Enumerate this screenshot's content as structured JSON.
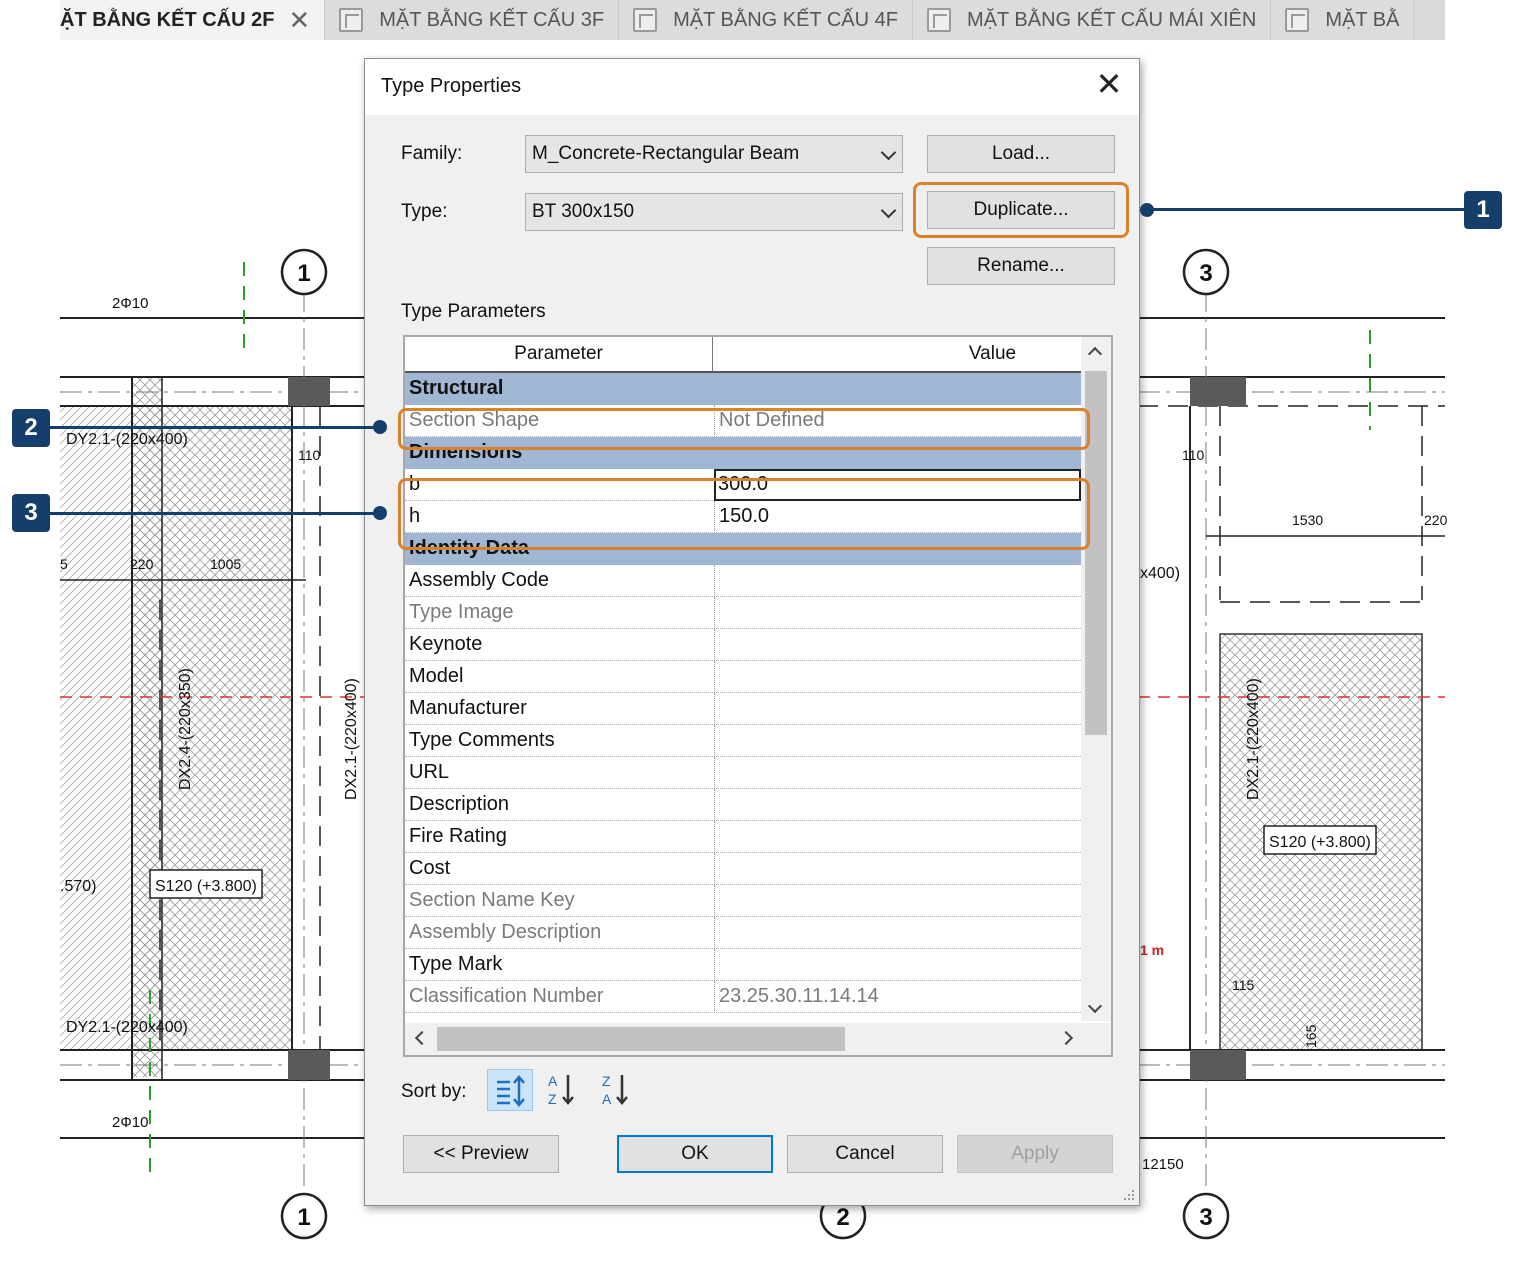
{
  "tabs": [
    {
      "label": "ẶT BẰNG KẾT CẤU 2F",
      "active": true
    },
    {
      "label": "MẶT BẰNG KẾT CẤU 3F",
      "active": false
    },
    {
      "label": "MẶT BẰNG KẾT CẤU 4F",
      "active": false
    },
    {
      "label": "MẶT BẰNG KẾT CẤU MÁI XIÊN",
      "active": false
    },
    {
      "label": "MẶT BẰ",
      "active": false
    }
  ],
  "drawing": {
    "grid_labels": [
      "1",
      "2",
      "3"
    ],
    "texts": [
      "2Ф10",
      "DY2.1-(220x400)",
      "110",
      "220",
      "1005",
      "5",
      "DX2.4-(220x350)",
      "DX2.1-(220x400)",
      ".570)",
      "S120 (+3.800)",
      "2Ф10",
      "1530",
      "220",
      "x400)",
      "1 m",
      "115",
      "165",
      "12150"
    ]
  },
  "dialog": {
    "title": "Type Properties",
    "family_label": "Family:",
    "family_value": "M_Concrete-Rectangular Beam",
    "type_label": "Type:",
    "type_value": "BT 300x150",
    "load_button": "Load...",
    "duplicate_button": "Duplicate...",
    "rename_button": "Rename...",
    "type_parameters_label": "Type Parameters",
    "grid": {
      "col_parameter": "Parameter",
      "col_value": "Value",
      "rows": [
        {
          "kind": "section",
          "parameter": "Structural",
          "value": ""
        },
        {
          "kind": "dim",
          "parameter": "Section Shape",
          "value": "Not Defined"
        },
        {
          "kind": "section",
          "parameter": "Dimensions",
          "value": ""
        },
        {
          "kind": "edit",
          "parameter": "b",
          "value": "300.0"
        },
        {
          "kind": "normal",
          "parameter": "h",
          "value": "150.0"
        },
        {
          "kind": "section",
          "parameter": "Identity Data",
          "value": ""
        },
        {
          "kind": "normal",
          "parameter": "Assembly Code",
          "value": ""
        },
        {
          "kind": "dim",
          "parameter": "Type Image",
          "value": ""
        },
        {
          "kind": "normal",
          "parameter": "Keynote",
          "value": ""
        },
        {
          "kind": "normal",
          "parameter": "Model",
          "value": ""
        },
        {
          "kind": "normal",
          "parameter": "Manufacturer",
          "value": ""
        },
        {
          "kind": "normal",
          "parameter": "Type Comments",
          "value": ""
        },
        {
          "kind": "normal",
          "parameter": "URL",
          "value": ""
        },
        {
          "kind": "normal",
          "parameter": "Description",
          "value": ""
        },
        {
          "kind": "normal",
          "parameter": "Fire Rating",
          "value": ""
        },
        {
          "kind": "normal",
          "parameter": "Cost",
          "value": ""
        },
        {
          "kind": "dim",
          "parameter": "Section Name Key",
          "value": ""
        },
        {
          "kind": "dim",
          "parameter": "Assembly Description",
          "value": ""
        },
        {
          "kind": "normal",
          "parameter": "Type Mark",
          "value": ""
        },
        {
          "kind": "dim",
          "parameter": "Classification Number",
          "value": "23.25.30.11.14.14"
        }
      ]
    },
    "sort_by_label": "Sort by:",
    "preview_button": "<< Preview",
    "ok_button": "OK",
    "cancel_button": "Cancel",
    "apply_button": "Apply"
  },
  "callouts": [
    "1",
    "2",
    "3"
  ],
  "colors": {
    "highlight": "#d9822b",
    "callout": "#163e6b",
    "section_row": "#9fb7d3"
  }
}
